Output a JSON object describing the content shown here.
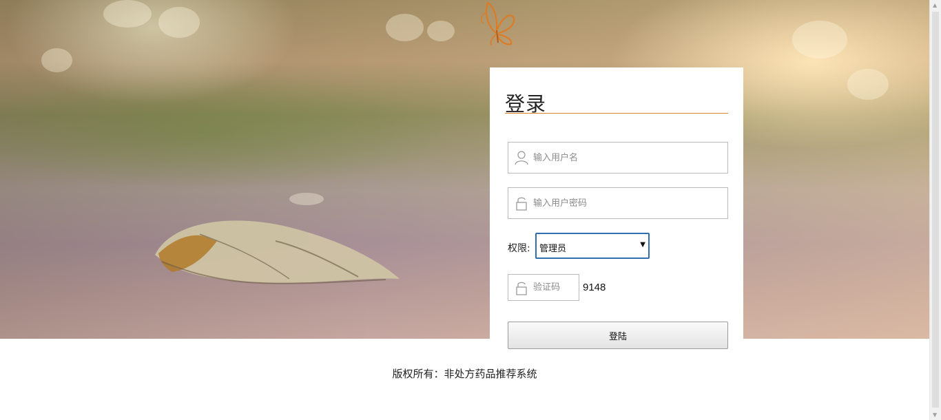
{
  "login": {
    "title": "登录",
    "username_placeholder": "输入用户名",
    "password_placeholder": "输入用户密码",
    "role_label": "权限:",
    "role_value": "管理员",
    "captcha_placeholder": "验证码",
    "captcha_code": "9148",
    "submit_label": "登陆"
  },
  "footer": {
    "copyright": "版权所有：非处方药品推荐系统"
  },
  "colors": {
    "accent": "#e07a1f",
    "title_underline": "#d9822b",
    "select_border": "#2f6fb0"
  },
  "icons": {
    "logo": "butterfly-logo-icon",
    "username": "user-icon",
    "password": "lock-icon",
    "captcha": "lock-icon"
  }
}
